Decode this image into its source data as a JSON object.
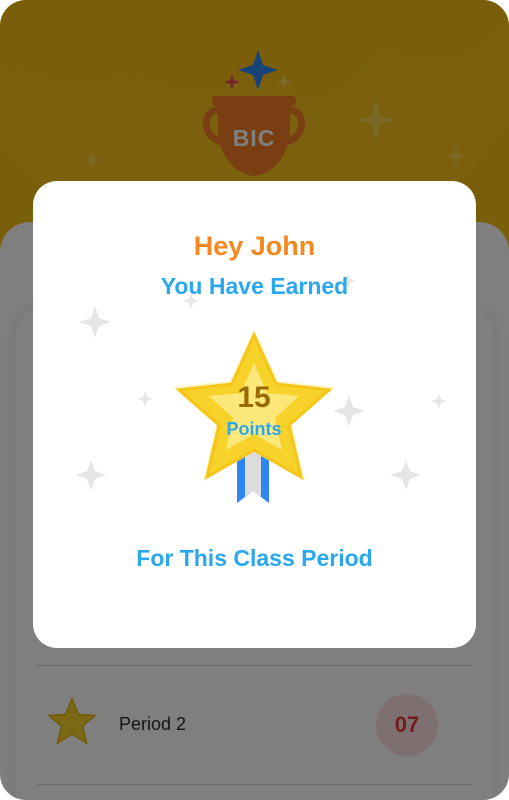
{
  "app": {
    "trophy_label": "BIC",
    "period_row": {
      "name": "Period 2",
      "count": "07"
    }
  },
  "modal": {
    "greeting": "Hey John",
    "earned_text": "You Have Earned",
    "points_value": "15",
    "points_label": "Points",
    "footer_text": "For This Class Period"
  },
  "colors": {
    "header_yellow": "#f6c21c",
    "trophy_orange": "#f27f27",
    "greeting_orange": "#f5881f",
    "accent_blue": "#2aa8ee",
    "star_gold": "#f7d22a",
    "ribbon_blue": "#2f86f0",
    "badge_red": "#e23b3b"
  }
}
